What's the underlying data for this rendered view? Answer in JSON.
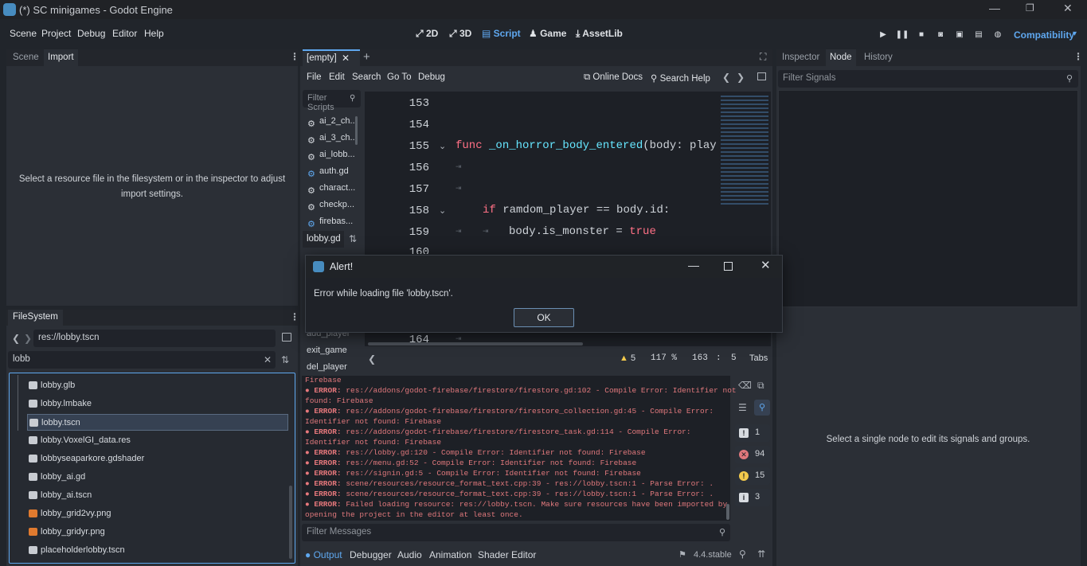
{
  "window": {
    "title": "(*) SC minigames  - Godot Engine",
    "min": "—",
    "max": "❐",
    "close": "✕"
  },
  "menu": [
    "Scene",
    "Project",
    "Debug",
    "Editor",
    "Help"
  ],
  "workspaces": [
    "2D",
    "3D",
    "Script",
    "Game",
    "AssetLib"
  ],
  "active_workspace": "Script",
  "renderer": "Compatibility",
  "left_top": {
    "tabs": [
      "Scene",
      "Import"
    ],
    "active": "Import",
    "message": "Select a resource file in the filesystem or in the inspector to adjust import settings."
  },
  "filesystem": {
    "title": "FileSystem",
    "path": "res://lobby.tscn",
    "filter": "lobb",
    "items": [
      {
        "name": "lobby.glb",
        "color": "#c8ccd2"
      },
      {
        "name": "lobby.lmbake",
        "color": "#c8ccd2"
      },
      {
        "name": "lobby.tscn",
        "color": "#c8ccd2",
        "selected": true
      },
      {
        "name": "lobby.VoxelGI_data.res",
        "color": "#c8ccd2"
      },
      {
        "name": "lobbyseaparkore.gdshader",
        "color": "#c8ccd2"
      },
      {
        "name": "lobby_ai.gd",
        "color": "#c8ccd2"
      },
      {
        "name": "lobby_ai.tscn",
        "color": "#c8ccd2"
      },
      {
        "name": "lobby_grid2vy.png",
        "color": "#e07a2f"
      },
      {
        "name": "lobby_gridyr.png",
        "color": "#e07a2f"
      },
      {
        "name": "placeholderlobby.tscn",
        "color": "#c8ccd2"
      }
    ]
  },
  "script_editor": {
    "tab": "[empty]",
    "menus": [
      "File",
      "Edit",
      "Search",
      "Go To",
      "Debug"
    ],
    "online_docs": "Online Docs",
    "search_help": "Search Help",
    "filter_scripts": "Filter Scripts",
    "scripts": [
      "ai_2_ch...",
      "ai_3_ch...",
      "ai_lobb...",
      "auth.gd",
      "charact...",
      "checkp...",
      "firebas..."
    ],
    "current_script": "lobby.gd",
    "methods": [
      "add_player",
      "exit_game",
      "del_player"
    ],
    "lines": [
      "153",
      "154",
      "155",
      "156",
      "157",
      "158",
      "159",
      "160",
      "164"
    ],
    "code": {
      "func_kw": "func",
      "func_name": "_on_horror_body_entered",
      "func_args": "(body: play",
      "if_kw": "if",
      "if_rest": "ramdom_player == body.id:",
      "assign": "body.is_monster = ",
      "true_kw": "true"
    },
    "status": {
      "warnings": "5",
      "zoom": "117 %",
      "line": "163",
      "col": "5",
      "indent": "Tabs"
    }
  },
  "output": {
    "lines": [
      {
        "type": "plain",
        "text": "Firebase"
      },
      {
        "type": "err",
        "text": "res://addons/godot-firebase/firestore/firestore.gd:102 - Compile Error: Identifier not"
      },
      {
        "type": "plain",
        "text": "found: Firebase"
      },
      {
        "type": "err",
        "text": "res://addons/godot-firebase/firestore/firestore_collection.gd:45 - Compile Error:"
      },
      {
        "type": "plain",
        "text": "Identifier not found: Firebase"
      },
      {
        "type": "err",
        "text": "res://addons/godot-firebase/firestore/firestore_task.gd:114 - Compile Error:"
      },
      {
        "type": "plain",
        "text": "Identifier not found: Firebase"
      },
      {
        "type": "err",
        "text": "res://lobby.gd:120 - Compile Error: Identifier not found: Firebase"
      },
      {
        "type": "err",
        "text": "res://menu.gd:52 - Compile Error: Identifier not found: Firebase"
      },
      {
        "type": "err",
        "text": "res://signin.gd:5 - Compile Error: Identifier not found: Firebase"
      },
      {
        "type": "err",
        "text": "scene/resources/resource_format_text.cpp:39 - res://lobby.tscn:1 - Parse Error: ."
      },
      {
        "type": "err",
        "text": "scene/resources/resource_format_text.cpp:39 - res://lobby.tscn:1 - Parse Error: ."
      },
      {
        "type": "err",
        "text": "Failed loading resource: res://lobby.tscn. Make sure resources have been imported by"
      },
      {
        "type": "plain",
        "text": "opening the project in the editor at least once."
      }
    ],
    "error_prefix": "● ERROR:",
    "filter_placeholder": "Filter Messages",
    "counts": {
      "info": "1",
      "errors": "94",
      "warnings": "15",
      "messages": "3"
    }
  },
  "bottom_tabs": [
    "Output",
    "Debugger",
    "Audio",
    "Animation",
    "Shader Editor"
  ],
  "active_bottom_tab": "Output",
  "version": "4.4.stable",
  "right_panel": {
    "tabs": [
      "Inspector",
      "Node",
      "History"
    ],
    "active": "Node",
    "filter": "Filter Signals",
    "message": "Select a single node to edit its signals and groups."
  },
  "dialog": {
    "title": "Alert!",
    "message": "Error while loading file 'lobby.tscn'.",
    "ok": "OK"
  },
  "colors": {
    "accent": "#5fa8f0",
    "error": "#e0787c",
    "keyword": "#ff7085",
    "function": "#66e6ff",
    "bool": "#ff7085"
  }
}
